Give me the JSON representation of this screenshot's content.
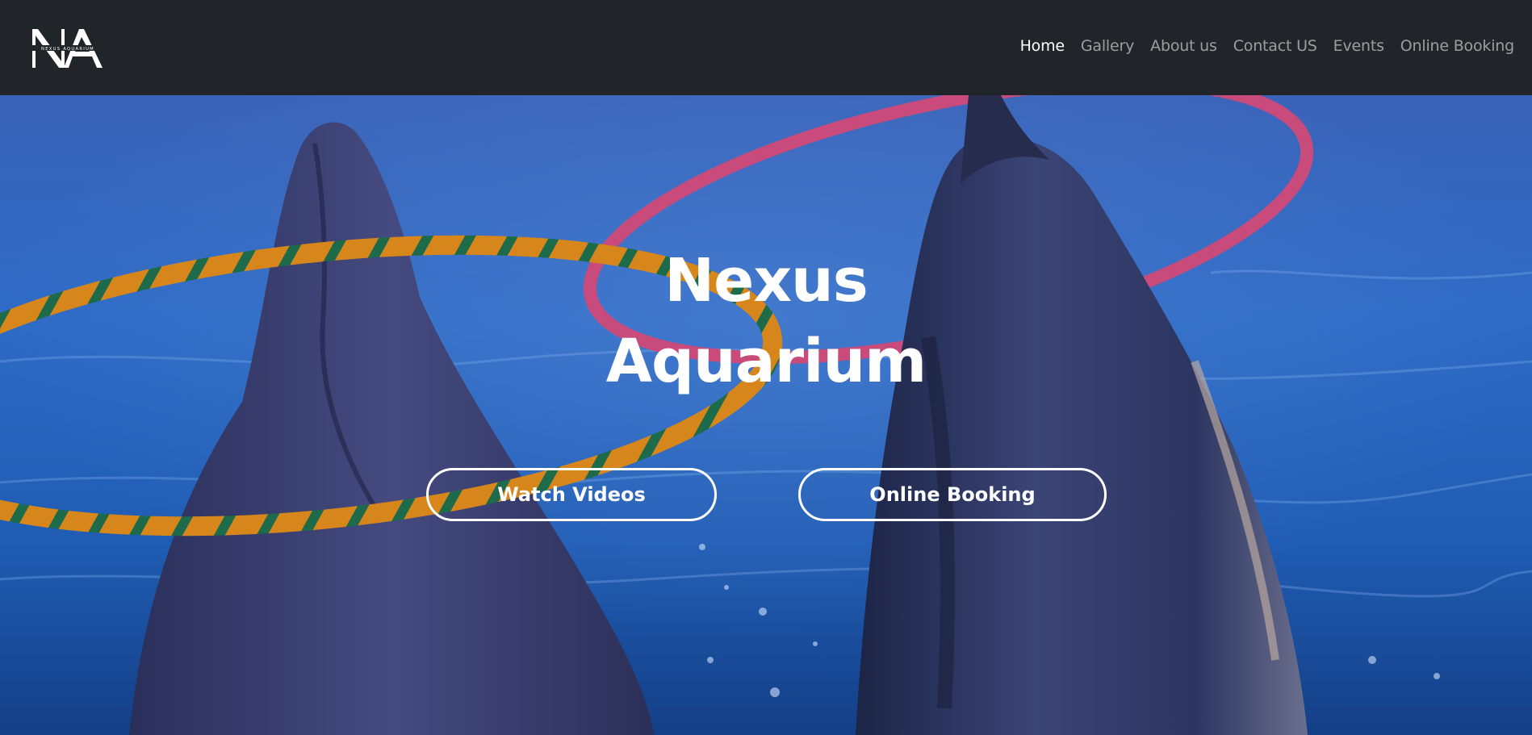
{
  "brand": {
    "logo_letters": "NA",
    "logo_text": "NEXUS AQUARIUM"
  },
  "nav": {
    "items": [
      {
        "label": "Home",
        "active": true
      },
      {
        "label": "Gallery",
        "active": false
      },
      {
        "label": "About us",
        "active": false
      },
      {
        "label": "Contact US",
        "active": false
      },
      {
        "label": "Events",
        "active": false
      },
      {
        "label": "Online Booking",
        "active": false
      }
    ]
  },
  "hero": {
    "title_line1": "Nexus",
    "title_line2": "Aquarium",
    "buttons": {
      "watch_videos": "Watch Videos",
      "online_booking": "Online Booking"
    }
  },
  "colors": {
    "navbar_bg": "#212529",
    "nav_active": "#ffffff",
    "nav_inactive": "#9a9da0",
    "water": "#1f5cb3",
    "ring_pink": "#c94b7c",
    "ring_orange": "#d6861a",
    "ring_green": "#1d6b4a"
  }
}
